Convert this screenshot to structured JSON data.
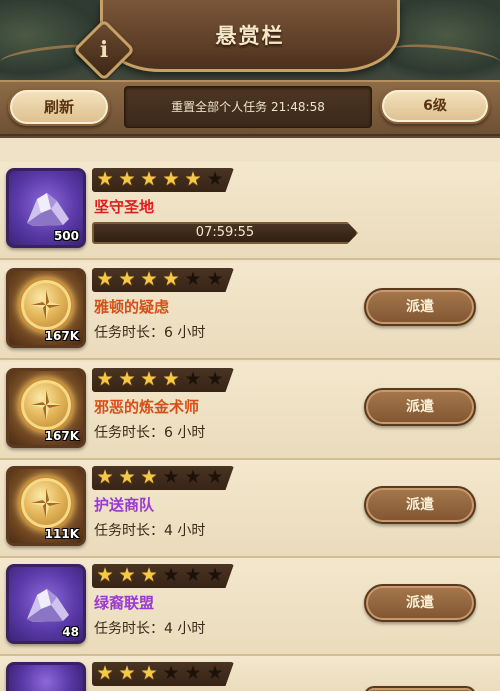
{
  "header": {
    "title": "悬赏栏",
    "info_label": "i"
  },
  "topbar": {
    "refresh_label": "刷新",
    "reset_text": "重置全部个人任务 21:48:58",
    "level_label": "6级"
  },
  "tasks": [
    {
      "icon": "purple-crystal-icon",
      "reward_count": "500",
      "stars": 5,
      "stars_max": 6,
      "name": "坚守圣地",
      "name_color": "#dd1e1e",
      "timer": "07:59:55",
      "in_progress": true
    },
    {
      "icon": "gold-coin-icon",
      "reward_count": "167K",
      "stars": 4,
      "stars_max": 6,
      "name": "雅顿的疑虑",
      "duration": "任务时长：6 小时",
      "action": "派遣"
    },
    {
      "icon": "gold-coin-icon",
      "reward_count": "167K",
      "stars": 4,
      "stars_max": 6,
      "name": "邪恶的炼金术师",
      "duration": "任务时长：6 小时",
      "action": "派遣"
    },
    {
      "icon": "gold-coin-icon",
      "reward_count": "111K",
      "stars": 3,
      "stars_max": 6,
      "name": "护送商队",
      "name_color": "#9b3ad1",
      "duration": "任务时长：4 小时",
      "action": "派遣"
    },
    {
      "icon": "purple-crystal-icon",
      "reward_count": "48",
      "stars": 3,
      "stars_max": 6,
      "name": "绿裔联盟",
      "name_color": "#9b3ad1",
      "duration": "任务时长：4 小时",
      "action": "派遣"
    },
    {
      "icon": "purple-crystal-icon",
      "stars": 3,
      "stars_max": 6,
      "partial": true
    }
  ]
}
